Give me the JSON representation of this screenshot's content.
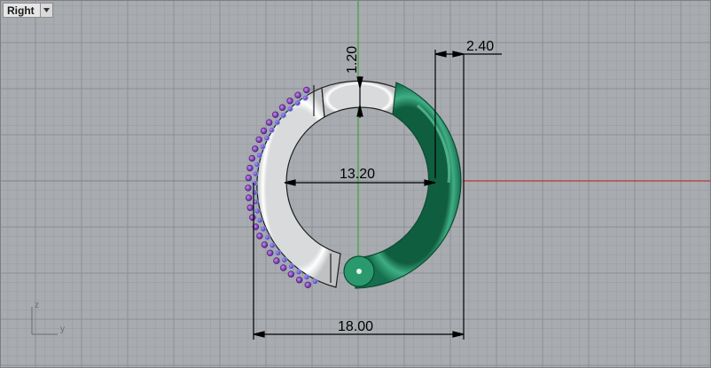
{
  "viewport": {
    "name": "Right",
    "menu_icon": "triangle-down-icon",
    "colors": {
      "background": "#a8abaf",
      "grid_minor": "#9c9fa3",
      "grid_major": "#8c8f93",
      "x_axis": "#b23a3a",
      "z_axis": "#3aa33a",
      "ring_white": "#f4f4f4",
      "ring_green": "#1f8a63",
      "gems": "#7c3fb0",
      "gem_outline": "#6fb0f0"
    }
  },
  "dimensions": {
    "band_thickness": "1.20",
    "wall_width": "2.40",
    "inner_diameter": "13.20",
    "outer_diameter": "18.00"
  },
  "axis_labels": {
    "vertical": "z",
    "horizontal": "y"
  }
}
